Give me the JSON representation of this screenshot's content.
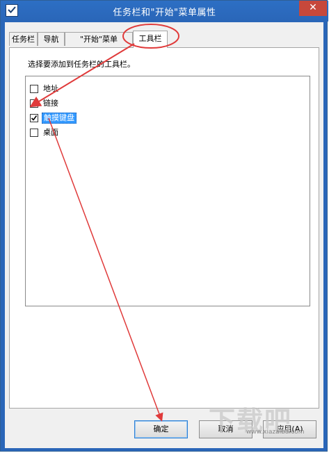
{
  "window": {
    "title": "任务栏和\"开始\"菜单属性",
    "close_glyph": "✕"
  },
  "tabs": [
    {
      "label": "任务栏",
      "active": false
    },
    {
      "label": "导航",
      "active": false
    },
    {
      "label": "\"开始\"菜单",
      "active": false
    },
    {
      "label": "工具栏",
      "active": true
    }
  ],
  "toolbars_panel": {
    "instruction": "选择要添加到任务栏的工具栏。",
    "items": [
      {
        "label": "地址",
        "checked": false,
        "selected": false
      },
      {
        "label": "链接",
        "checked": false,
        "selected": false
      },
      {
        "label": "触摸键盘",
        "checked": true,
        "selected": true
      },
      {
        "label": "桌面",
        "checked": false,
        "selected": false
      }
    ]
  },
  "buttons": {
    "ok": "确定",
    "cancel": "取消",
    "apply": "应用(A)"
  },
  "watermark": {
    "brand": "下载吧",
    "url": "www.xiazaiba.com"
  },
  "colors": {
    "titlebar": "#2a66b8",
    "close_button": "#c7483b",
    "selection": "#3399ff",
    "annotation": "#e03a3a"
  }
}
